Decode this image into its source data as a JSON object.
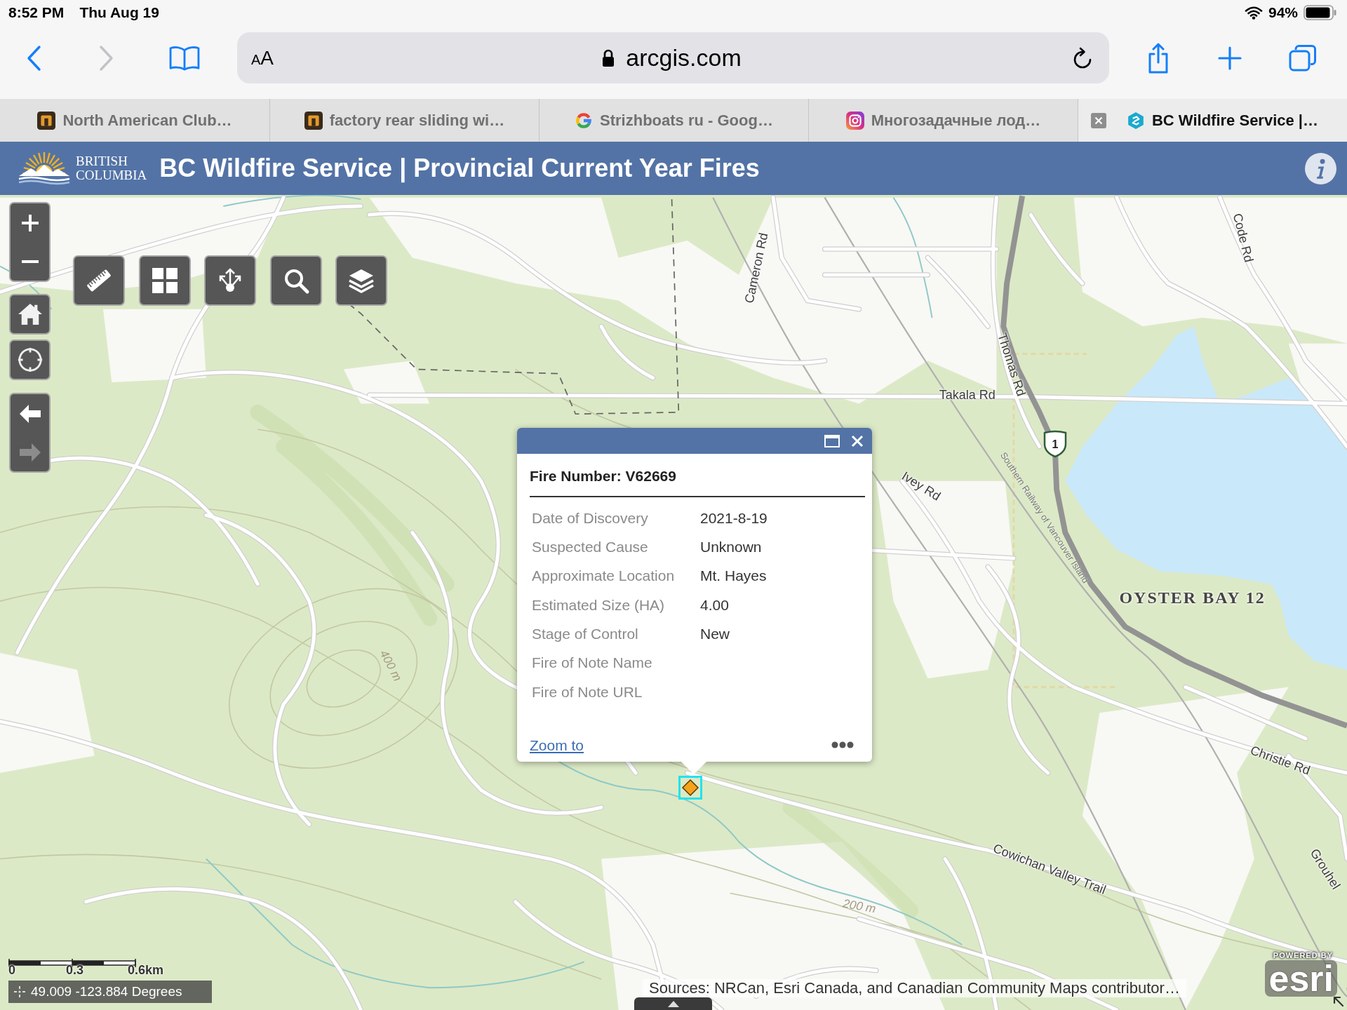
{
  "status_bar": {
    "time": "8:52 PM",
    "date": "Thu Aug 19",
    "battery": "94%"
  },
  "browser": {
    "nav_buttons": [
      {
        "disabled": false
      },
      {
        "disabled": true
      }
    ],
    "text_size": "AA",
    "url": "arcgis.com",
    "tabs": [
      {
        "title": "North American Club…",
        "selected": false,
        "kind": "tile"
      },
      {
        "title": "factory rear sliding wi…",
        "selected": false,
        "kind": "tile"
      },
      {
        "title": "Strizhboats ru - Goog…",
        "selected": false,
        "kind": "ring"
      },
      {
        "title": "Многозадачные лод…",
        "selected": false,
        "kind": "camera"
      },
      {
        "title": "BC Wildfire Service |…",
        "selected": true,
        "kind": "hexagon"
      }
    ]
  },
  "app_header": {
    "logo_lines": [
      "BRITISH",
      "COLUMBIA"
    ],
    "title": "BC Wildfire Service | Provincial Current Year Fires"
  },
  "map": {
    "history_buttons": [
      {
        "disabled": false
      },
      {
        "disabled": true
      }
    ],
    "labels": [
      {
        "text": "Cameron Rd",
        "kind": "road"
      },
      {
        "text": "Code Rd",
        "kind": "road"
      },
      {
        "text": "Thomas Rd",
        "kind": "road"
      },
      {
        "text": "Takala Rd",
        "kind": "road"
      },
      {
        "text": "Ivey Rd",
        "kind": "road"
      },
      {
        "text": "Southern Railway of Vancouver Island",
        "kind": "railway"
      },
      {
        "text": "OYSTER BAY 12",
        "kind": "place"
      },
      {
        "text": "Christie Rd",
        "kind": "road"
      },
      {
        "text": "Cowichan Valley Trail",
        "kind": "road"
      },
      {
        "text": "Grouhel",
        "kind": "road"
      },
      {
        "text": "400 m",
        "kind": "contour"
      },
      {
        "text": "200 m",
        "kind": "contour"
      }
    ],
    "route_shield": "1",
    "popup": {
      "title": "Fire Number: V62669",
      "fields": [
        {
          "label": "Date of Discovery",
          "value": "2021-8-19"
        },
        {
          "label": "Suspected Cause",
          "value": "Unknown"
        },
        {
          "label": "Approximate Location",
          "value": "Mt. Hayes"
        },
        {
          "label": "Estimated Size (HA)",
          "value": "4.00"
        },
        {
          "label": "Stage of Control",
          "value": "New"
        },
        {
          "label": "Fire of Note Name"
        },
        {
          "label": "Fire of Note URL"
        }
      ],
      "link": "Zoom to"
    },
    "scale": [
      "0",
      "0.3",
      "0.6km"
    ],
    "coordinates": "49.009 -123.884 Degrees",
    "attribution": "Sources: NRCan, Esri Canada, and Canadian Community Maps contributor…",
    "powered_by": "POWERED BY",
    "logo": "esri"
  }
}
